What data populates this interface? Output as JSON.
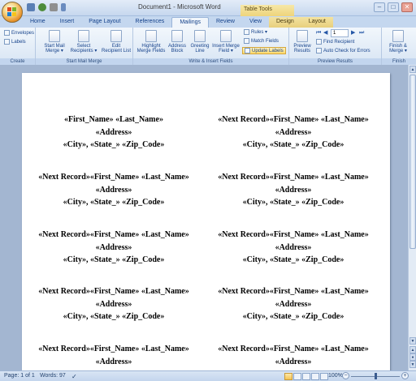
{
  "window": {
    "title": "Document1 - Microsoft Word",
    "context_tab": "Table Tools"
  },
  "tabs": [
    "Home",
    "Insert",
    "Page Layout",
    "References",
    "Mailings",
    "Review",
    "View",
    "Design",
    "Layout"
  ],
  "active_tab": "Mailings",
  "ribbon": {
    "create": {
      "envelopes": "Envelopes",
      "labels": "Labels",
      "label": "Create"
    },
    "start_mail_merge": {
      "start": [
        "Start Mail",
        "Merge ▾"
      ],
      "select": [
        "Select",
        "Recipients ▾"
      ],
      "edit": [
        "Edit",
        "Recipient List"
      ],
      "label": "Start Mail Merge"
    },
    "write_insert": {
      "highlight": [
        "Highlight",
        "Merge Fields"
      ],
      "address": [
        "Address",
        "Block"
      ],
      "greeting": [
        "Greeting",
        "Line"
      ],
      "insert_field": [
        "Insert Merge",
        "Field ▾"
      ],
      "rules": "Rules ▾",
      "match_fields": "Match Fields",
      "update_labels": "Update Labels",
      "label": "Write & Insert Fields"
    },
    "preview": {
      "preview_results": [
        "Preview",
        "Results"
      ],
      "record_number": "1",
      "find_recipient": "Find Recipient",
      "auto_check": "Auto Check for Errors",
      "label": "Preview Results"
    },
    "finish": {
      "finish_merge": [
        "Finish &",
        "Merge ▾"
      ],
      "label": "Finish"
    }
  },
  "labels": [
    {
      "line1": "«First_Name» «Last_Name»",
      "line2": "«Address»",
      "line3": "«City», «State_» «Zip_Code»"
    },
    {
      "line1": "«Next Record»«First_Name» «Last_Name»",
      "line2": "«Address»",
      "line3": "«City», «State_» «Zip_Code»"
    },
    {
      "line1": "«Next Record»«First_Name» «Last_Name»",
      "line2": "«Address»",
      "line3": "«City», «State_» «Zip_Code»"
    },
    {
      "line1": "«Next Record»«First_Name» «Last_Name»",
      "line2": "«Address»",
      "line3": "«City», «State_» «Zip_Code»"
    },
    {
      "line1": "«Next Record»«First_Name» «Last_Name»",
      "line2": "«Address»",
      "line3": "«City», «State_» «Zip_Code»"
    },
    {
      "line1": "«Next Record»«First_Name» «Last_Name»",
      "line2": "«Address»",
      "line3": "«City», «State_» «Zip_Code»"
    },
    {
      "line1": "«Next Record»«First_Name» «Last_Name»",
      "line2": "«Address»",
      "line3": "«City», «State_» «Zip_Code»"
    },
    {
      "line1": "«Next Record»«First_Name» «Last_Name»",
      "line2": "«Address»",
      "line3": "«City», «State_» «Zip_Code»"
    },
    {
      "line1": "«Next Record»«First_Name» «Last_Name»",
      "line2": "«Address»",
      "line3": ""
    },
    {
      "line1": "«Next Record»«First_Name» «Last_Name»",
      "line2": "«Address»",
      "line3": ""
    }
  ],
  "status": {
    "page": "Page: 1 of 1",
    "words": "Words: 97",
    "zoom": "100%"
  },
  "icons": [
    "office-button-icon",
    "save-icon",
    "undo-icon",
    "redo-icon",
    "minimize-icon",
    "maximize-icon",
    "close-icon",
    "envelope-icon",
    "labels-icon",
    "first-record-icon",
    "previous-record-icon",
    "next-record-icon",
    "last-record-icon",
    "proofing-icon"
  ]
}
